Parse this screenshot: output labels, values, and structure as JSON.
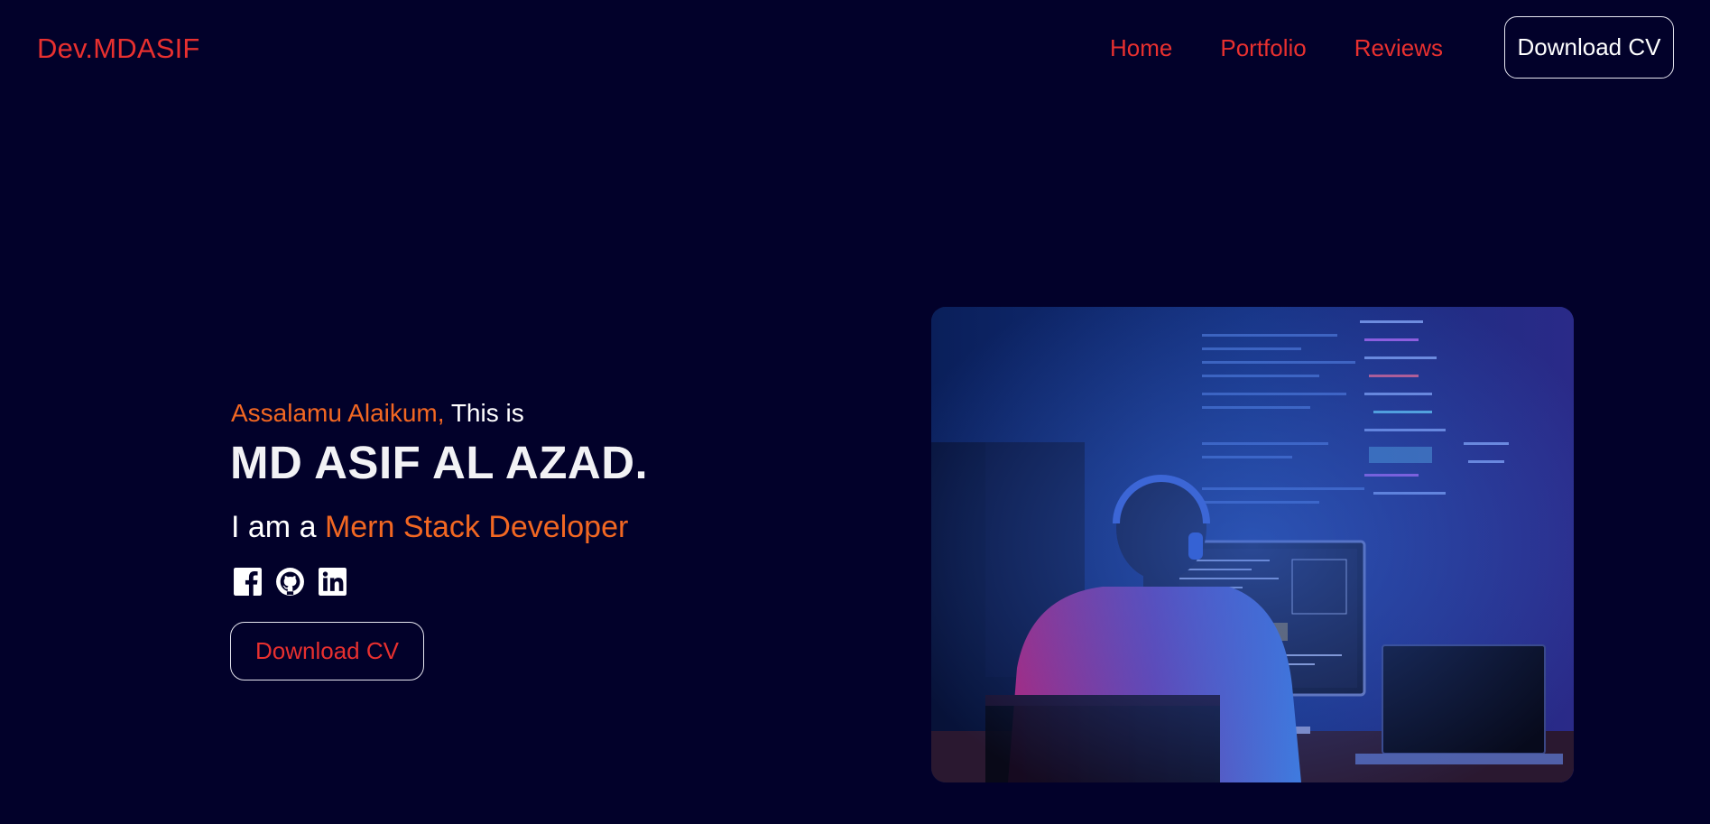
{
  "header": {
    "logo": "Dev.MDASIF",
    "nav": [
      {
        "label": "Home"
      },
      {
        "label": "Portfolio"
      },
      {
        "label": "Reviews"
      }
    ],
    "download_cv_label": "Download CV"
  },
  "hero": {
    "greeting_accent": "Assalamu Alaikum,",
    "greeting_rest": " This is",
    "name": "MD ASIF AL AZAD.",
    "role_prefix": "I am a ",
    "role_accent": "Mern Stack Developer",
    "socials": [
      {
        "icon": "facebook-icon"
      },
      {
        "icon": "github-icon"
      },
      {
        "icon": "linkedin-icon"
      }
    ],
    "download_cv_label": "Download CV"
  },
  "colors": {
    "background": "#02012a",
    "brand_red": "#e8302f",
    "accent_orange": "#f26722",
    "text_white": "#ffffff"
  }
}
